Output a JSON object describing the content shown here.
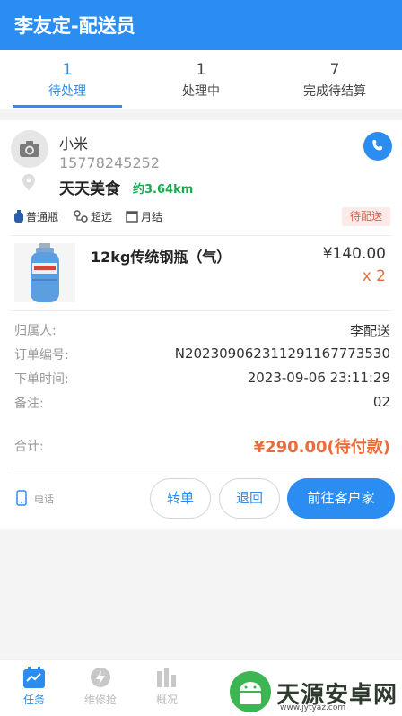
{
  "header": {
    "title": "李友定-配送员"
  },
  "tabs": [
    {
      "count": "1",
      "label": "待处理"
    },
    {
      "count": "1",
      "label": "处理中"
    },
    {
      "count": "7",
      "label": "完成待结算"
    }
  ],
  "order": {
    "customer_name": "小米",
    "customer_phone": "15778245252",
    "shop_name": "天天美食",
    "distance": "约3.64km",
    "tags": [
      "普通瓶",
      "超远",
      "月结"
    ],
    "status": "待配送",
    "product": {
      "name": "12kg传统钢瓶（气）",
      "price": "¥140.00",
      "qty": "x 2"
    },
    "info": [
      {
        "key": "归属人:",
        "value": "李配送"
      },
      {
        "key": "订单编号:",
        "value": "N202309062311291167773530"
      },
      {
        "key": "下单时间:",
        "value": "2023-09-06 23:11:29"
      },
      {
        "key": "备注:",
        "value": "02"
      }
    ],
    "total_label": "合计:",
    "total_value": "¥290.00(待付款)",
    "phone_label": "电话",
    "actions": {
      "transfer": "转单",
      "return": "退回",
      "go": "前往客户家"
    }
  },
  "bottom_nav": [
    {
      "label": "任务",
      "icon": "calendar-icon"
    },
    {
      "label": "维修抢",
      "icon": "bolt-icon"
    },
    {
      "label": "概况",
      "icon": "bar-chart-icon"
    }
  ],
  "watermark": {
    "text": "天源安卓网",
    "url": "www.jytyaz.com"
  },
  "colors": {
    "primary": "#2b8df1",
    "accent": "#ea6b3b",
    "status_bg": "#fde9e7",
    "distance": "#1aa94c"
  }
}
